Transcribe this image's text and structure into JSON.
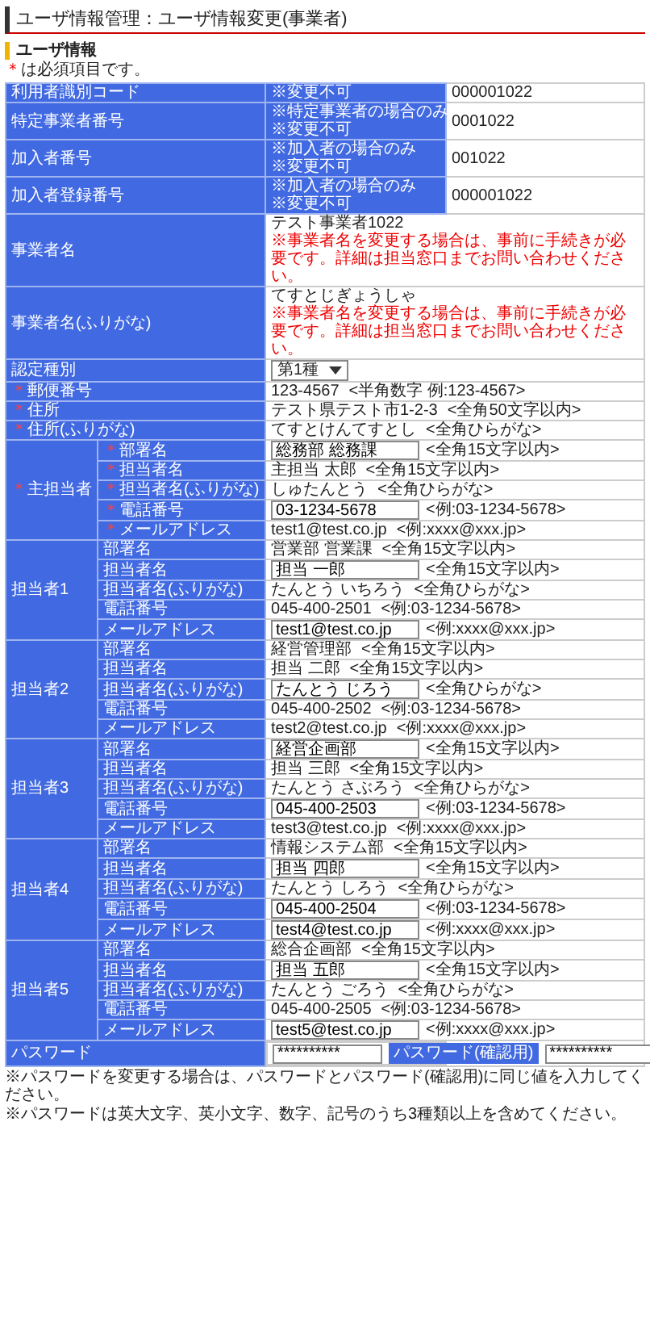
{
  "title": "ユーザ情報管理：ユーザ情報変更(事業者)",
  "section_title": "ユーザ情報",
  "required_mark": "＊",
  "required_note": "は必須項目です。",
  "top_rows": [
    {
      "label": "利用者識別コード",
      "notes": [
        "※変更不可"
      ],
      "kind": "text",
      "value": "000001022",
      "required": false
    },
    {
      "label": "特定事業者番号",
      "notes": [
        "※特定事業者の場合のみ",
        "※変更不可"
      ],
      "kind": "text",
      "value": "0001022",
      "required": false
    },
    {
      "label": "加入者番号",
      "notes": [
        "※加入者の場合のみ",
        "※変更不可"
      ],
      "kind": "text",
      "value": "001022",
      "required": false
    },
    {
      "label": "加入者登録番号",
      "notes": [
        "※加入者の場合のみ",
        "※変更不可"
      ],
      "kind": "text",
      "value": "000001022",
      "required": false
    },
    {
      "label": "事業者名",
      "kind": "text",
      "value": "テスト事業者1022",
      "warning": "※事業者名を変更する場合は、事前に手続きが必要です。詳細は担当窓口までお問い合わせください。",
      "required": false
    },
    {
      "label": "事業者名(ふりがな)",
      "kind": "text",
      "value": "てすとじぎょうしゃ",
      "warning": "※事業者名を変更する場合は、事前に手続きが必要です。詳細は担当窓口までお問い合わせください。",
      "required": false
    },
    {
      "label": "認定種別",
      "kind": "select",
      "value": "第1種",
      "required": false
    },
    {
      "label": "郵便番号",
      "kind": "text",
      "value": "123-4567",
      "hint": "<半角数字 例:123-4567>",
      "required": true
    },
    {
      "label": "住所",
      "kind": "text",
      "value": "テスト県テスト市1-2-3",
      "hint": "<全角50文字以内>",
      "required": true
    },
    {
      "label": "住所(ふりがな)",
      "kind": "text",
      "value": "てすとけんてすとし",
      "hint": "<全角ひらがな>",
      "required": true
    }
  ],
  "groups": [
    {
      "label": "主担当者",
      "required": true,
      "fields": [
        {
          "label": "部署名",
          "kind": "input",
          "value": "総務部 総務課",
          "hint": "<全角15文字以内>",
          "required": true
        },
        {
          "label": "担当者名",
          "kind": "text",
          "value": "主担当 太郎",
          "hint": "<全角15文字以内>",
          "required": true
        },
        {
          "label": "担当者名(ふりがな)",
          "kind": "text",
          "value": "しゅたんとう",
          "hint": "<全角ひらがな>",
          "required": true
        },
        {
          "label": "電話番号",
          "kind": "input",
          "value": "03-1234-5678",
          "hint": "<例:03-1234-5678>",
          "required": true
        },
        {
          "label": "メールアドレス",
          "kind": "text",
          "value": "test1@test.co.jp",
          "hint": "<例:xxxx@xxx.jp>",
          "required": true
        }
      ]
    },
    {
      "label": "担当者1",
      "required": false,
      "fields": [
        {
          "label": "部署名",
          "kind": "text",
          "value": "営業部 営業課",
          "hint": "<全角15文字以内>",
          "required": false
        },
        {
          "label": "担当者名",
          "kind": "input",
          "value": "担当 一郎",
          "hint": "<全角15文字以内>",
          "required": false
        },
        {
          "label": "担当者名(ふりがな)",
          "kind": "text",
          "value": "たんとう いちろう",
          "hint": "<全角ひらがな>",
          "required": false
        },
        {
          "label": "電話番号",
          "kind": "text",
          "value": "045-400-2501",
          "hint": "<例:03-1234-5678>",
          "required": false
        },
        {
          "label": "メールアドレス",
          "kind": "input",
          "value": "test1@test.co.jp",
          "hint": "<例:xxxx@xxx.jp>",
          "required": false
        }
      ]
    },
    {
      "label": "担当者2",
      "required": false,
      "fields": [
        {
          "label": "部署名",
          "kind": "text",
          "value": "経営管理部",
          "hint": "<全角15文字以内>",
          "required": false
        },
        {
          "label": "担当者名",
          "kind": "text",
          "value": "担当 二郎",
          "hint": "<全角15文字以内>",
          "required": false
        },
        {
          "label": "担当者名(ふりがな)",
          "kind": "input",
          "value": "たんとう じろう",
          "hint": "<全角ひらがな>",
          "required": false
        },
        {
          "label": "電話番号",
          "kind": "text",
          "value": "045-400-2502",
          "hint": "<例:03-1234-5678>",
          "required": false
        },
        {
          "label": "メールアドレス",
          "kind": "text",
          "value": "test2@test.co.jp",
          "hint": "<例:xxxx@xxx.jp>",
          "required": false
        }
      ]
    },
    {
      "label": "担当者3",
      "required": false,
      "fields": [
        {
          "label": "部署名",
          "kind": "input",
          "value": "経営企画部",
          "hint": "<全角15文字以内>",
          "required": false
        },
        {
          "label": "担当者名",
          "kind": "text",
          "value": "担当 三郎",
          "hint": "<全角15文字以内>",
          "required": false
        },
        {
          "label": "担当者名(ふりがな)",
          "kind": "text",
          "value": "たんとう さぶろう",
          "hint": "<全角ひらがな>",
          "required": false
        },
        {
          "label": "電話番号",
          "kind": "input",
          "value": "045-400-2503",
          "hint": "<例:03-1234-5678>",
          "required": false
        },
        {
          "label": "メールアドレス",
          "kind": "text",
          "value": "test3@test.co.jp",
          "hint": "<例:xxxx@xxx.jp>",
          "required": false
        }
      ]
    },
    {
      "label": "担当者4",
      "required": false,
      "fields": [
        {
          "label": "部署名",
          "kind": "text",
          "value": "情報システム部",
          "hint": "<全角15文字以内>",
          "required": false
        },
        {
          "label": "担当者名",
          "kind": "input",
          "value": "担当 四郎",
          "hint": "<全角15文字以内>",
          "required": false
        },
        {
          "label": "担当者名(ふりがな)",
          "kind": "text",
          "value": "たんとう しろう",
          "hint": "<全角ひらがな>",
          "required": false
        },
        {
          "label": "電話番号",
          "kind": "input",
          "value": "045-400-2504",
          "hint": "<例:03-1234-5678>",
          "required": false
        },
        {
          "label": "メールアドレス",
          "kind": "input",
          "value": "test4@test.co.jp",
          "hint": "<例:xxxx@xxx.jp>",
          "required": false
        }
      ]
    },
    {
      "label": "担当者5",
      "required": false,
      "fields": [
        {
          "label": "部署名",
          "kind": "text",
          "value": "総合企画部",
          "hint": "<全角15文字以内>",
          "required": false
        },
        {
          "label": "担当者名",
          "kind": "input",
          "value": "担当 五郎",
          "hint": "<全角15文字以内>",
          "required": false
        },
        {
          "label": "担当者名(ふりがな)",
          "kind": "text",
          "value": "たんとう ごろう",
          "hint": "<全角ひらがな>",
          "required": false
        },
        {
          "label": "電話番号",
          "kind": "text",
          "value": "045-400-2505",
          "hint": "<例:03-1234-5678>",
          "required": false
        },
        {
          "label": "メールアドレス",
          "kind": "input",
          "value": "test5@test.co.jp",
          "hint": "<例:xxxx@xxx.jp>",
          "required": false
        }
      ]
    }
  ],
  "password": {
    "label": "パスワード",
    "value": "**********",
    "confirm_label": "パスワード(確認用)",
    "confirm_value": "**********"
  },
  "notes": [
    "※パスワードを変更する場合は、パスワードとパスワード(確認用)に同じ値を入力してください。",
    "※パスワードは英大文字、英小文字、数字、記号のうち3種類以上を含めてください。"
  ]
}
